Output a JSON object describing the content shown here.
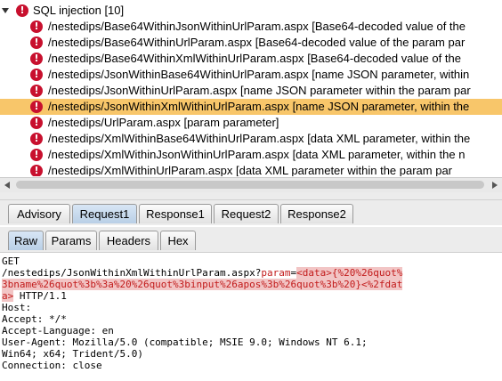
{
  "tree": {
    "category": "SQL injection [10]",
    "issues": [
      {
        "path": "/nestedips/Base64WithinJsonWithinUrlParam.aspx",
        "detail": "[Base64-decoded value of the"
      },
      {
        "path": "/nestedips/Base64WithinUrlParam.aspx",
        "detail": "[Base64-decoded value of the param par"
      },
      {
        "path": "/nestedips/Base64WithinXmlWithinUrlParam.aspx",
        "detail": "[Base64-decoded value of the"
      },
      {
        "path": "/nestedips/JsonWithinBase64WithinUrlParam.aspx",
        "detail": "[name JSON parameter, within"
      },
      {
        "path": "/nestedips/JsonWithinUrlParam.aspx",
        "detail": "[name JSON parameter within the param par"
      },
      {
        "path": "/nestedips/JsonWithinXmlWithinUrlParam.aspx",
        "detail": "[name JSON parameter, within the"
      },
      {
        "path": "/nestedips/UrlParam.aspx",
        "detail": "[param parameter]"
      },
      {
        "path": "/nestedips/XmlWithinBase64WithinUrlParam.aspx",
        "detail": "[data XML parameter, within the"
      },
      {
        "path": "/nestedips/XmlWithinJsonWithinUrlParam.aspx",
        "detail": "[data XML parameter, within the n"
      },
      {
        "path": "/nestedips/XmlWithinUrlParam.aspx",
        "detail": "[data XML parameter within the param par"
      }
    ],
    "selected_index": 5
  },
  "detail_tabs": [
    "Advisory",
    "Request1",
    "Response1",
    "Request2",
    "Response2"
  ],
  "active_detail_tab": "Request1",
  "view_tabs": [
    "Raw",
    "Params",
    "Headers",
    "Hex"
  ],
  "active_view_tab": "Raw",
  "request": {
    "line1": "GET",
    "line2_path": "/nestedips/JsonWithinXmlWithinUrlParam.aspx?",
    "line2_param": "param",
    "line2_eq": "=",
    "line2_payload": "<data>{%20%26quot%",
    "line3_payload": "3bname%26quot%3b%3a%20%26quot%3binput%26apos%3b%26quot%3b%20}<%2fdat",
    "line4_payload": "a>",
    "line4_rest": " HTTP/1.1",
    "headers": [
      "Host:",
      "Accept: */*",
      "Accept-Language: en",
      "User-Agent: Mozilla/5.0 (compatible; MSIE 9.0; Windows NT 6.1;",
      "Win64; x64; Trident/5.0)",
      "Connection: close"
    ]
  },
  "colors": {
    "selection": "#f8c66a",
    "issue_icon": "#c8102e",
    "payload_highlight": "#f2c5c5",
    "payload_text": "#c21b1b"
  },
  "icons": {
    "expand": "triangle-down-icon",
    "issue": "exclamation-circle-icon"
  }
}
